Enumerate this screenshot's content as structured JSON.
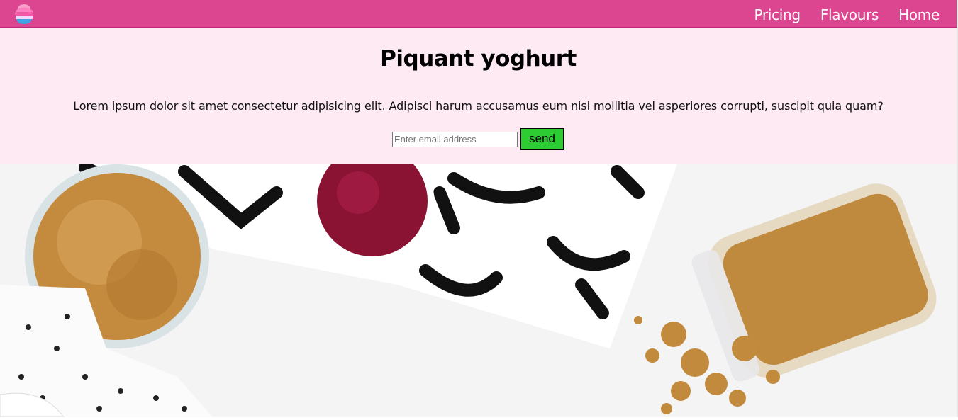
{
  "nav": {
    "logo_name": "ice-cream-logo",
    "links": [
      "Pricing",
      "Flavours",
      "Home"
    ]
  },
  "hero": {
    "title": "Piquant yoghurt",
    "text": "Lorem ipsum dolor sit amet consectetur adipisicing elit. Adipisci harum accusamus eum nisi mollitia vel asperiores corrupti, suscipit quia quam?",
    "email_placeholder": "Enter email address",
    "send_label": "send"
  },
  "colors": {
    "nav_bg": "#dc4590",
    "hero_bg": "#fdeaf3",
    "send_bg": "#2ecc33"
  }
}
